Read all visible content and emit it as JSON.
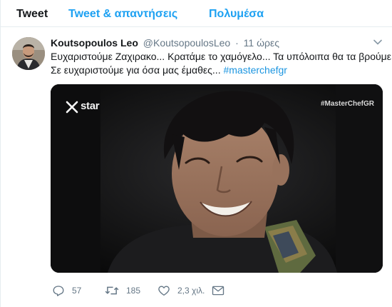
{
  "tabs": {
    "tweets": "Tweet",
    "tweets_replies": "Tweet & απαντήσεις",
    "media": "Πολυμέσα"
  },
  "tweet": {
    "author_name": "Koutsopoulos Leo",
    "author_handle": "@KoutsopoulosLeo",
    "separator": "·",
    "time": "11 ώρες",
    "text_line1": "Ευχαριστούμε Ζαχιρακο... Κρατάμε το χαμόγελο... Τα υπόλοιπα θα τα βρούμε...",
    "text_line2": "Σε ευχαριστούμε για όσα μας έμαθες...",
    "hashtag": "#masterchefgr",
    "media": {
      "channel_logo": "star",
      "hashtag_overlay": "#MasterChefGR"
    },
    "actions": {
      "replies": "57",
      "retweets": "185",
      "likes": "2,3 χιλ."
    }
  },
  "colors": {
    "accent": "#1da1f2",
    "hashtag": "#1b95e0",
    "text_primary": "#14171a",
    "text_secondary": "#657786"
  }
}
